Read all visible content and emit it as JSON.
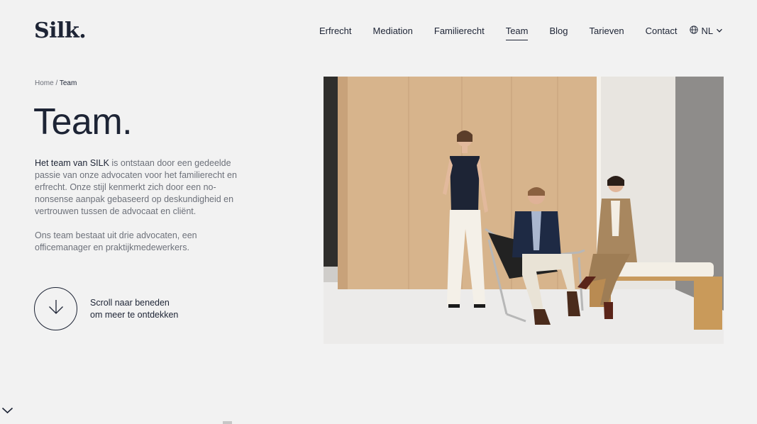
{
  "header": {
    "logo": "Silk.",
    "nav": [
      {
        "label": "Erfrecht",
        "active": false
      },
      {
        "label": "Mediation",
        "active": false
      },
      {
        "label": "Familierecht",
        "active": false
      },
      {
        "label": "Team",
        "active": true
      },
      {
        "label": "Blog",
        "active": false
      },
      {
        "label": "Tarieven",
        "active": false
      },
      {
        "label": "Contact",
        "active": false
      }
    ],
    "language": "NL"
  },
  "breadcrumb": {
    "home": "Home",
    "separator": " / ",
    "current": "Team"
  },
  "hero": {
    "title": "Team.",
    "intro_highlight": "Het team van SILK",
    "intro_rest": " is ontstaan door een gedeelde passie van onze advocaten voor het familierecht en erfrecht. Onze stijl kenmerkt zich door een no-nonsense aanpak gebaseerd op deskundigheid en vertrouwen tussen de advocaat en cliënt.",
    "intro_second": "Ons team bestaat uit drie advocaten, een officemanager en praktijkmedewerkers.",
    "scroll_line1": "Scroll naar beneden",
    "scroll_line2": "om meer te ontdekken"
  },
  "colors": {
    "background": "#f2f2f2",
    "text_dark": "#1d2435",
    "text_muted": "#6d717a"
  }
}
